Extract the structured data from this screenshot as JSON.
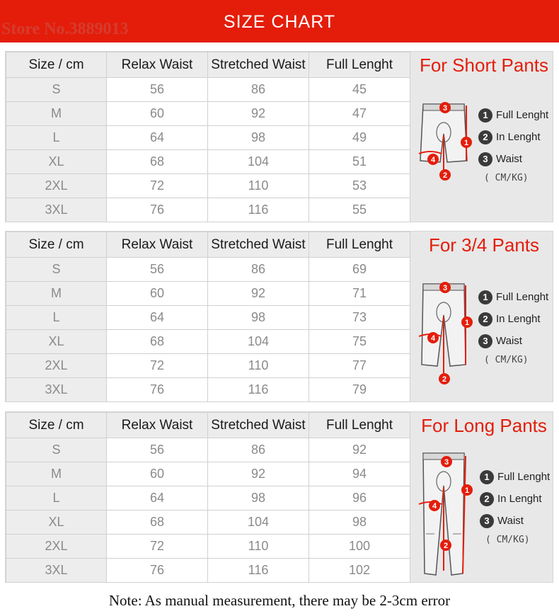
{
  "header": {
    "title": "SIZE CHART",
    "watermark": "Store No.3889013"
  },
  "columns": [
    "Size / cm",
    "Relax Waist",
    "Stretched Waist",
    "Full Lenght"
  ],
  "legend": {
    "item1": "Full Lenght",
    "item2": "In Lenght",
    "item3": "Waist",
    "unit": "( CM/KG)"
  },
  "sections": [
    {
      "title": "For Short Pants",
      "rows": [
        {
          "size": "S",
          "relax": "56",
          "stretched": "86",
          "full": "45"
        },
        {
          "size": "M",
          "relax": "60",
          "stretched": "92",
          "full": "47"
        },
        {
          "size": "L",
          "relax": "64",
          "stretched": "98",
          "full": "49"
        },
        {
          "size": "XL",
          "relax": "68",
          "stretched": "104",
          "full": "51"
        },
        {
          "size": "2XL",
          "relax": "72",
          "stretched": "110",
          "full": "53"
        },
        {
          "size": "3XL",
          "relax": "76",
          "stretched": "116",
          "full": "55"
        }
      ]
    },
    {
      "title": "For 3/4 Pants",
      "rows": [
        {
          "size": "S",
          "relax": "56",
          "stretched": "86",
          "full": "69"
        },
        {
          "size": "M",
          "relax": "60",
          "stretched": "92",
          "full": "71"
        },
        {
          "size": "L",
          "relax": "64",
          "stretched": "98",
          "full": "73"
        },
        {
          "size": "XL",
          "relax": "68",
          "stretched": "104",
          "full": "75"
        },
        {
          "size": "2XL",
          "relax": "72",
          "stretched": "110",
          "full": "77"
        },
        {
          "size": "3XL",
          "relax": "76",
          "stretched": "116",
          "full": "79"
        }
      ]
    },
    {
      "title": "For Long Pants",
      "rows": [
        {
          "size": "S",
          "relax": "56",
          "stretched": "86",
          "full": "92"
        },
        {
          "size": "M",
          "relax": "60",
          "stretched": "92",
          "full": "94"
        },
        {
          "size": "L",
          "relax": "64",
          "stretched": "98",
          "full": "96"
        },
        {
          "size": "XL",
          "relax": "68",
          "stretched": "104",
          "full": "98"
        },
        {
          "size": "2XL",
          "relax": "72",
          "stretched": "110",
          "full": "100"
        },
        {
          "size": "3XL",
          "relax": "76",
          "stretched": "116",
          "full": "102"
        }
      ]
    }
  ],
  "diagram_markers": [
    "1",
    "2",
    "3",
    "4"
  ],
  "note": "Note: As manual measurement, there may be 2-3cm error",
  "colors": {
    "accent": "#e41d0b",
    "header_cell": "#ececec",
    "value_text": "#8a8a8a"
  }
}
